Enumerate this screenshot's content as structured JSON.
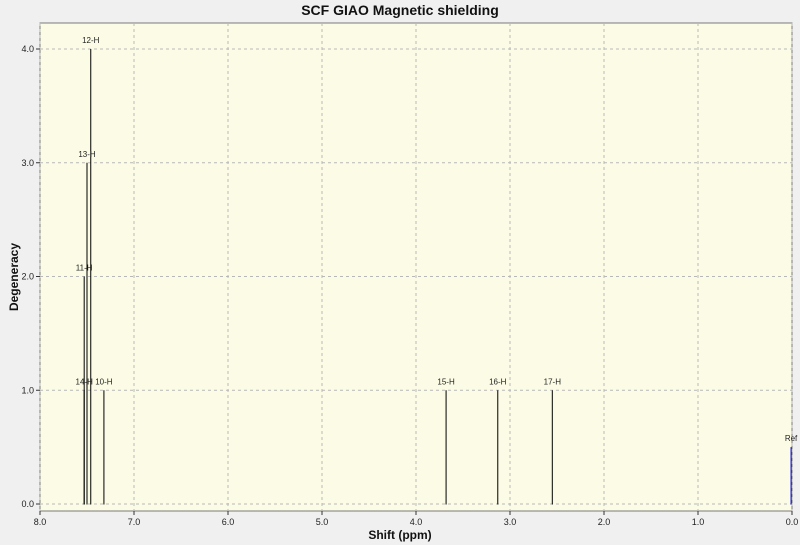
{
  "chart_data": {
    "type": "bar",
    "title": "SCF GIAO Magnetic shielding",
    "xlabel": "Shift (ppm)",
    "ylabel": "Degeneracy",
    "xlim": [
      8.0,
      0.0
    ],
    "ylim": [
      0.0,
      4.0
    ],
    "x_reversed": true,
    "grid": true,
    "x_ticks": [
      "8.0",
      "7.0",
      "6.0",
      "5.0",
      "4.0",
      "3.0",
      "2.0",
      "1.0",
      "0.0"
    ],
    "y_ticks": [
      "0.0",
      "1.0",
      "2.0",
      "3.0",
      "4.0"
    ],
    "peaks": [
      {
        "label": "12-H",
        "x": 7.46,
        "y": 4.0
      },
      {
        "label": "13-H",
        "x": 7.5,
        "y": 3.0
      },
      {
        "label": "11-H",
        "x": 7.53,
        "y": 2.0
      },
      {
        "label": "14-H",
        "x": 7.53,
        "y": 1.0
      },
      {
        "label": "10-H",
        "x": 7.32,
        "y": 1.0
      },
      {
        "label": "15-H",
        "x": 3.68,
        "y": 1.0
      },
      {
        "label": "16-H",
        "x": 3.13,
        "y": 1.0
      },
      {
        "label": "17-H",
        "x": 2.55,
        "y": 1.0
      },
      {
        "label": "Ref",
        "x": 0.01,
        "y": 0.5,
        "color": "#0000cc"
      }
    ]
  },
  "colors": {
    "plot_background": "#fcfce6",
    "grid": "#b8b8b8",
    "peak": "#000000",
    "reference": "#0000cc"
  }
}
